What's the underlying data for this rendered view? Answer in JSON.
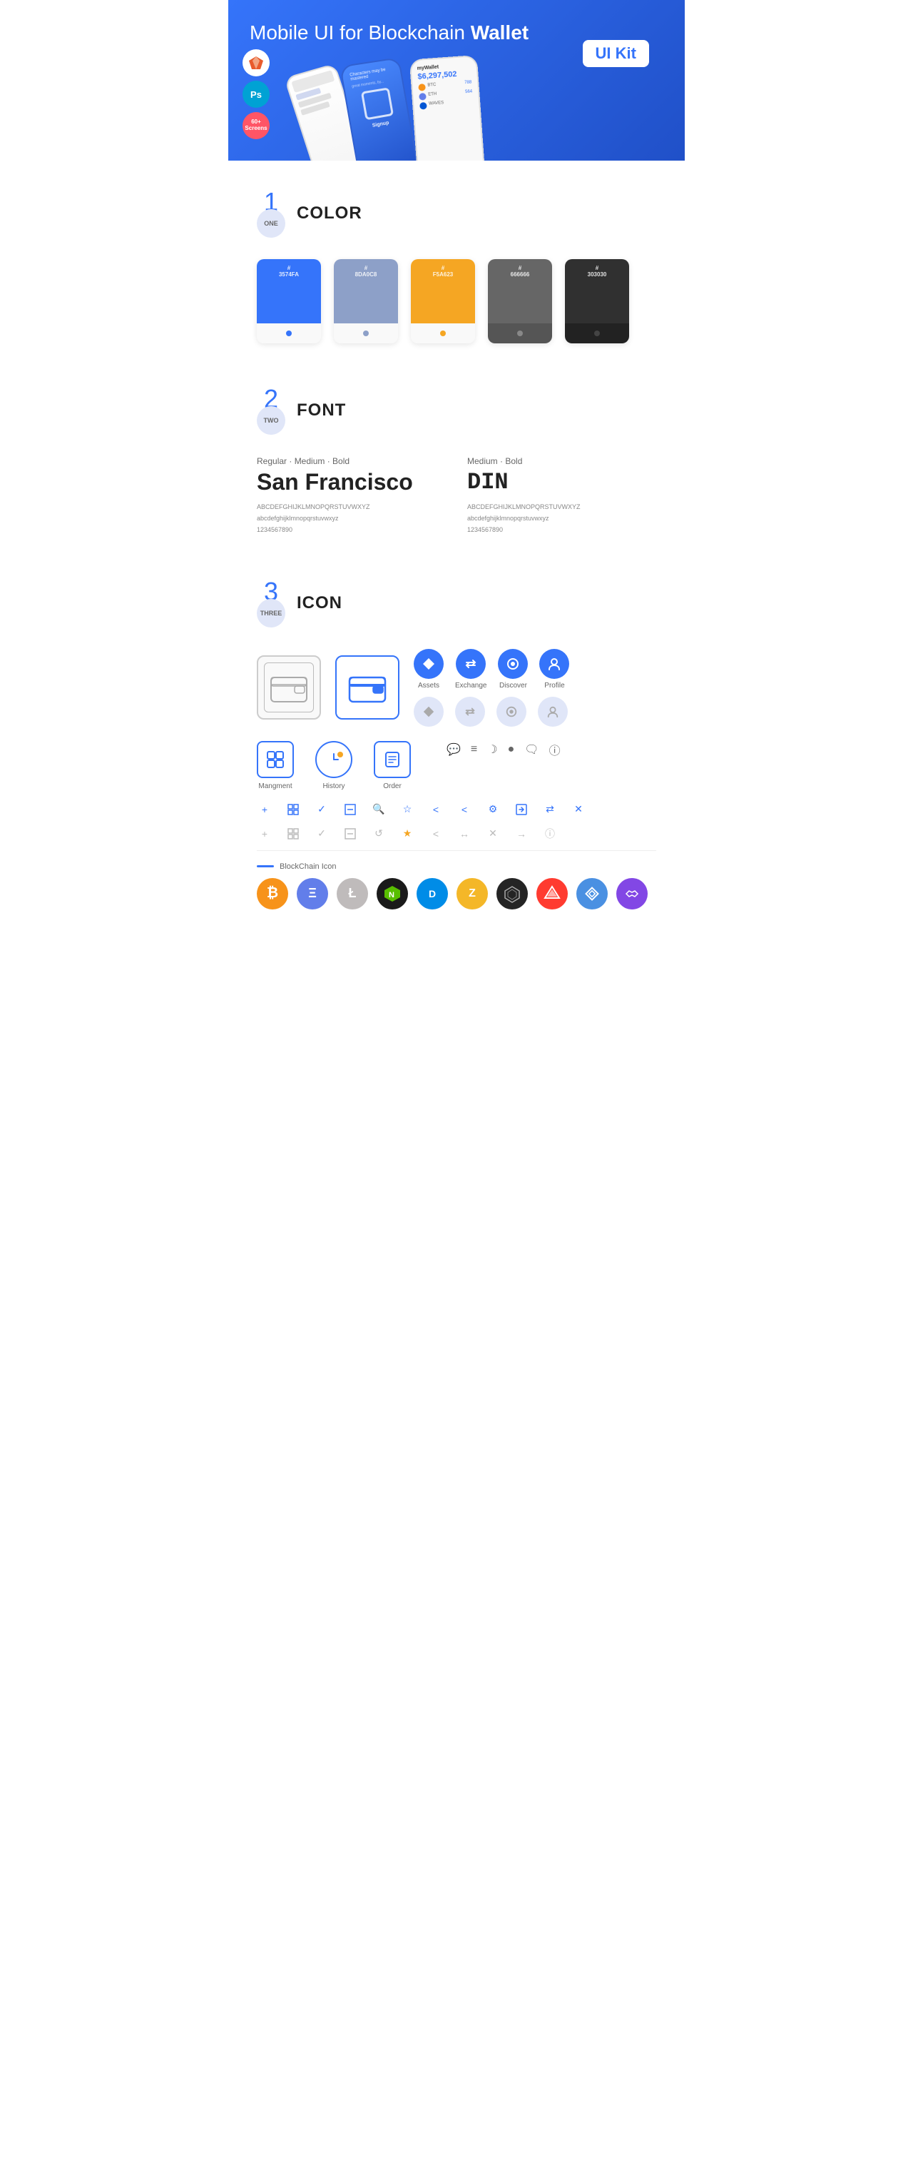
{
  "hero": {
    "title": "Mobile UI for Blockchain ",
    "title_bold": "Wallet",
    "badge": "UI Kit"
  },
  "badges": [
    {
      "id": "sketch",
      "label": "S",
      "bg": "#fff",
      "color": "#e85b2d"
    },
    {
      "id": "ps",
      "label": "Ps",
      "bg": "#00a2d4",
      "color": "#fff"
    },
    {
      "id": "screens",
      "label": "60+\nScreens",
      "bg": "#ff5566",
      "color": "#fff"
    }
  ],
  "sections": {
    "color": {
      "number": "1",
      "sub": "ONE",
      "title": "COLOR",
      "swatches": [
        {
          "id": "blue",
          "hex": "#3574FA",
          "display": "#\n3574FA",
          "dark": false
        },
        {
          "id": "gray",
          "hex": "#8DA0C8",
          "display": "#\n8DA0C8",
          "dark": false
        },
        {
          "id": "orange",
          "hex": "#F5A623",
          "display": "#\nF5A623",
          "dark": false
        },
        {
          "id": "darkgray",
          "hex": "#666666",
          "display": "#\n666666",
          "dark": true
        },
        {
          "id": "black",
          "hex": "#303030",
          "display": "#\n303030",
          "dark": true
        }
      ]
    },
    "font": {
      "number": "2",
      "sub": "TWO",
      "title": "FONT",
      "fonts": [
        {
          "id": "sf",
          "subtitle": "Regular · Medium · Bold",
          "name": "San Francisco",
          "upper": "ABCDEFGHIJKLMNOPQRSTUVWXYZ",
          "lower": "abcdefghijklmnopqrstuvwxyz",
          "nums": "1234567890"
        },
        {
          "id": "din",
          "subtitle": "Medium · Bold",
          "name": "DIN",
          "upper": "ABCDEFGHIJKLMNOPQRSTUVWXYZ",
          "lower": "abcdefghijklmnopqrstuvwxyz",
          "nums": "1234567890"
        }
      ]
    },
    "icon": {
      "number": "3",
      "sub": "THREE",
      "title": "ICON",
      "named_icons": [
        {
          "id": "assets",
          "label": "Assets",
          "symbol": "◆"
        },
        {
          "id": "exchange",
          "label": "Exchange",
          "symbol": "♻"
        },
        {
          "id": "discover",
          "label": "Discover",
          "symbol": "●"
        },
        {
          "id": "profile",
          "label": "Profile",
          "symbol": "👤"
        }
      ],
      "tab_icons": [
        {
          "id": "management",
          "label": "Mangment",
          "type": "box"
        },
        {
          "id": "history",
          "label": "History",
          "type": "clock"
        },
        {
          "id": "order",
          "label": "Order",
          "type": "list"
        }
      ],
      "small_icons_row1": [
        "+",
        "⊞",
        "✓",
        "⊟",
        "🔍",
        "☆",
        "<",
        "<",
        "⚙",
        "⊡",
        "⇄",
        "✕"
      ],
      "small_icons_row2": [
        "+",
        "⊞",
        "✓",
        "⊟",
        "🔄",
        "☆",
        "<",
        "↔",
        "✕",
        "→",
        "ⓘ"
      ],
      "blockchain_label": "BlockChain Icon",
      "crypto_icons": [
        {
          "id": "btc",
          "symbol": "₿",
          "bg": "#f7931a",
          "color": "#fff"
        },
        {
          "id": "eth",
          "symbol": "Ξ",
          "bg": "#627eea",
          "color": "#fff"
        },
        {
          "id": "ltc",
          "symbol": "Ł",
          "bg": "#bebebe",
          "color": "#fff"
        },
        {
          "id": "neo",
          "symbol": "N",
          "bg": "#58be00",
          "color": "#fff"
        },
        {
          "id": "dash",
          "symbol": "D",
          "bg": "#008ce7",
          "color": "#fff"
        },
        {
          "id": "zcash",
          "symbol": "Z",
          "bg": "#f4b728",
          "color": "#fff"
        },
        {
          "id": "iota",
          "symbol": "◇",
          "bg": "#242424",
          "color": "#fff"
        },
        {
          "id": "ark",
          "symbol": "▲",
          "bg": "#f70000",
          "color": "#fff"
        },
        {
          "id": "nano",
          "symbol": "◈",
          "bg": "#4a90e2",
          "color": "#fff"
        },
        {
          "id": "matic",
          "symbol": "M",
          "bg": "#8247e5",
          "color": "#fff"
        }
      ]
    }
  }
}
